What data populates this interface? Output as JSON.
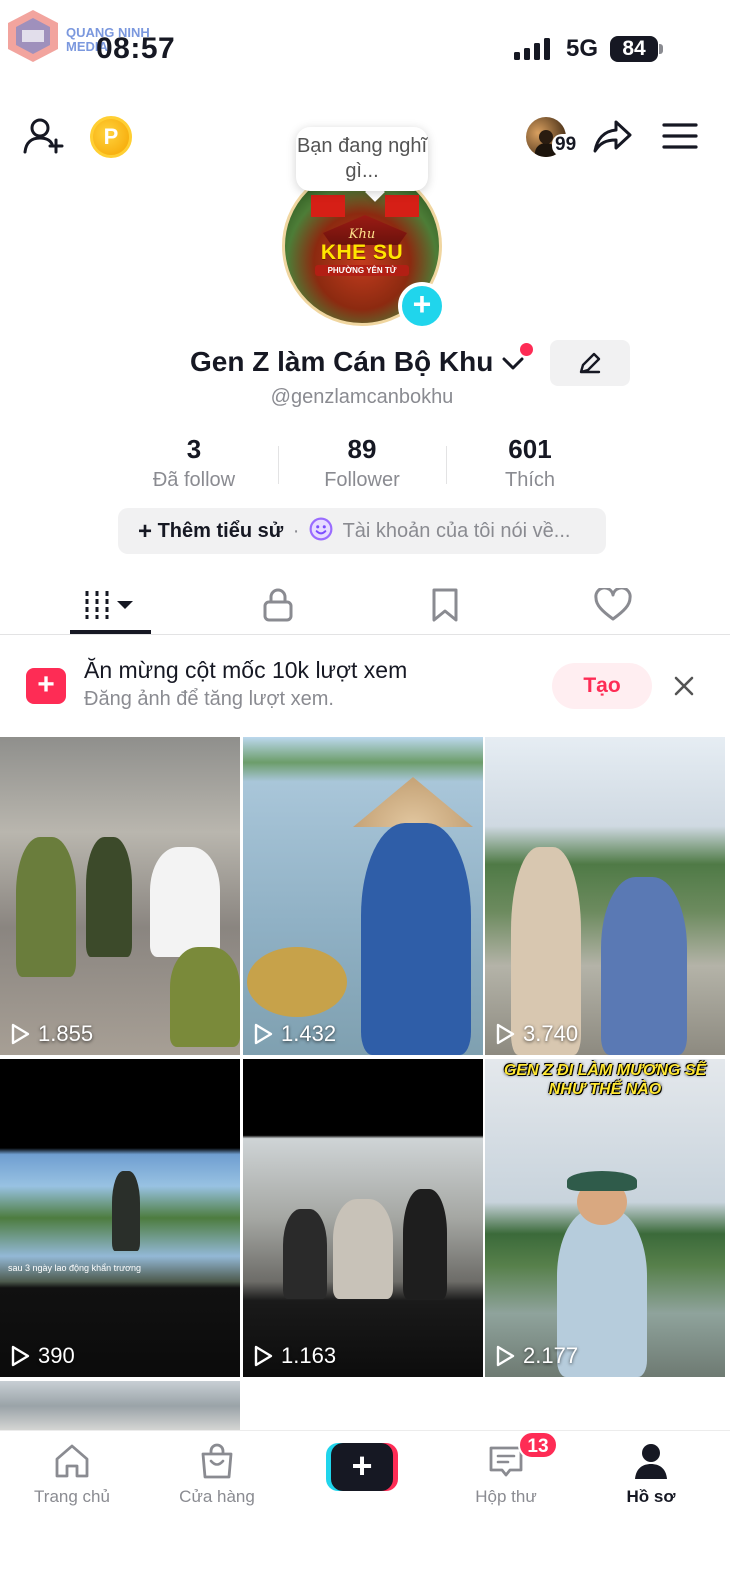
{
  "status_bar": {
    "time": "08:57",
    "network": "5G",
    "battery": "84",
    "watermark": [
      "QUANG NINH",
      "MEDIA"
    ]
  },
  "header": {
    "bubble": "Bạn đang nghĩ gì...",
    "notification_count": "99"
  },
  "avatar_art": {
    "script": "Khu",
    "title": "KHE SU",
    "subtitle": "PHƯỜNG YÊN TỬ"
  },
  "profile": {
    "name": "Gen Z làm Cán Bộ Khu",
    "handle": "@genzlamcanbokhu",
    "stats": [
      {
        "value": "3",
        "label": "Đã follow"
      },
      {
        "value": "89",
        "label": "Follower"
      },
      {
        "value": "601",
        "label": "Thích"
      }
    ],
    "bio_add": "Thêm tiểu sử",
    "bio_hint": "Tài khoản của tôi nói về..."
  },
  "tabs": [
    "videos-grid-icon",
    "lock-icon",
    "bookmark-icon",
    "heart-icon"
  ],
  "milestone": {
    "title": "Ăn mừng cột mốc 10k lượt xem",
    "subtitle": "Đăng ảnh để tăng lượt xem.",
    "button": "Tạo"
  },
  "videos": [
    {
      "views": "1.855"
    },
    {
      "views": "1.432"
    },
    {
      "views": "3.740"
    },
    {
      "views": "390",
      "caption": "sau 3 ngày lao động khẩn trương"
    },
    {
      "views": "1.163"
    },
    {
      "views": "2.177",
      "caption": "GEN Z ĐI LÀM MƯƠNG SẼ NHƯ THẾ NÀO"
    }
  ],
  "nav": {
    "home": "Trang chủ",
    "shop": "Cửa hàng",
    "inbox": "Hộp thư",
    "inbox_badge": "13",
    "profile": "Hồ sơ"
  },
  "colors": {
    "accent": "#fe2c55",
    "cyan": "#20d5ec",
    "text": "#161823",
    "muted": "#8a8b91"
  }
}
